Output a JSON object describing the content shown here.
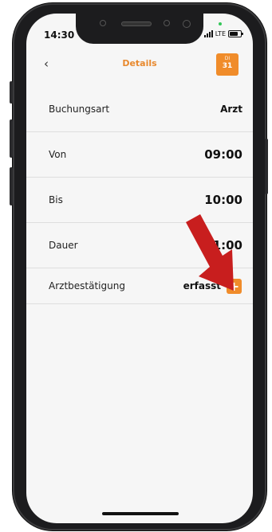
{
  "status": {
    "time": "14:30",
    "network": "LTE"
  },
  "header": {
    "back_icon": "chevron-left",
    "title": "Details",
    "date_dow": "DI",
    "date_day": "31",
    "accent_color": "#f08c2a"
  },
  "details": [
    {
      "label": "Buchungsart",
      "value": "Arzt"
    },
    {
      "label": "Von",
      "value": "09:00"
    },
    {
      "label": "Bis",
      "value": "10:00"
    },
    {
      "label": "Dauer",
      "value": "1:00"
    },
    {
      "label": "Arztbestätigung",
      "value": "erfasst",
      "action": "+"
    }
  ],
  "annotation": {
    "arrow_color": "#c81e1e"
  }
}
